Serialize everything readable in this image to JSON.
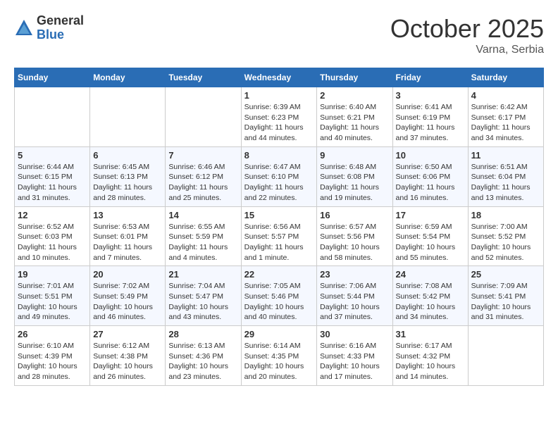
{
  "header": {
    "logo_general": "General",
    "logo_blue": "Blue",
    "month": "October 2025",
    "location": "Varna, Serbia"
  },
  "calendar": {
    "days_of_week": [
      "Sunday",
      "Monday",
      "Tuesday",
      "Wednesday",
      "Thursday",
      "Friday",
      "Saturday"
    ],
    "weeks": [
      [
        {
          "day": "",
          "info": ""
        },
        {
          "day": "",
          "info": ""
        },
        {
          "day": "",
          "info": ""
        },
        {
          "day": "1",
          "info": "Sunrise: 6:39 AM\nSunset: 6:23 PM\nDaylight: 11 hours\nand 44 minutes."
        },
        {
          "day": "2",
          "info": "Sunrise: 6:40 AM\nSunset: 6:21 PM\nDaylight: 11 hours\nand 40 minutes."
        },
        {
          "day": "3",
          "info": "Sunrise: 6:41 AM\nSunset: 6:19 PM\nDaylight: 11 hours\nand 37 minutes."
        },
        {
          "day": "4",
          "info": "Sunrise: 6:42 AM\nSunset: 6:17 PM\nDaylight: 11 hours\nand 34 minutes."
        }
      ],
      [
        {
          "day": "5",
          "info": "Sunrise: 6:44 AM\nSunset: 6:15 PM\nDaylight: 11 hours\nand 31 minutes."
        },
        {
          "day": "6",
          "info": "Sunrise: 6:45 AM\nSunset: 6:13 PM\nDaylight: 11 hours\nand 28 minutes."
        },
        {
          "day": "7",
          "info": "Sunrise: 6:46 AM\nSunset: 6:12 PM\nDaylight: 11 hours\nand 25 minutes."
        },
        {
          "day": "8",
          "info": "Sunrise: 6:47 AM\nSunset: 6:10 PM\nDaylight: 11 hours\nand 22 minutes."
        },
        {
          "day": "9",
          "info": "Sunrise: 6:48 AM\nSunset: 6:08 PM\nDaylight: 11 hours\nand 19 minutes."
        },
        {
          "day": "10",
          "info": "Sunrise: 6:50 AM\nSunset: 6:06 PM\nDaylight: 11 hours\nand 16 minutes."
        },
        {
          "day": "11",
          "info": "Sunrise: 6:51 AM\nSunset: 6:04 PM\nDaylight: 11 hours\nand 13 minutes."
        }
      ],
      [
        {
          "day": "12",
          "info": "Sunrise: 6:52 AM\nSunset: 6:03 PM\nDaylight: 11 hours\nand 10 minutes."
        },
        {
          "day": "13",
          "info": "Sunrise: 6:53 AM\nSunset: 6:01 PM\nDaylight: 11 hours\nand 7 minutes."
        },
        {
          "day": "14",
          "info": "Sunrise: 6:55 AM\nSunset: 5:59 PM\nDaylight: 11 hours\nand 4 minutes."
        },
        {
          "day": "15",
          "info": "Sunrise: 6:56 AM\nSunset: 5:57 PM\nDaylight: 11 hours\nand 1 minute."
        },
        {
          "day": "16",
          "info": "Sunrise: 6:57 AM\nSunset: 5:56 PM\nDaylight: 10 hours\nand 58 minutes."
        },
        {
          "day": "17",
          "info": "Sunrise: 6:59 AM\nSunset: 5:54 PM\nDaylight: 10 hours\nand 55 minutes."
        },
        {
          "day": "18",
          "info": "Sunrise: 7:00 AM\nSunset: 5:52 PM\nDaylight: 10 hours\nand 52 minutes."
        }
      ],
      [
        {
          "day": "19",
          "info": "Sunrise: 7:01 AM\nSunset: 5:51 PM\nDaylight: 10 hours\nand 49 minutes."
        },
        {
          "day": "20",
          "info": "Sunrise: 7:02 AM\nSunset: 5:49 PM\nDaylight: 10 hours\nand 46 minutes."
        },
        {
          "day": "21",
          "info": "Sunrise: 7:04 AM\nSunset: 5:47 PM\nDaylight: 10 hours\nand 43 minutes."
        },
        {
          "day": "22",
          "info": "Sunrise: 7:05 AM\nSunset: 5:46 PM\nDaylight: 10 hours\nand 40 minutes."
        },
        {
          "day": "23",
          "info": "Sunrise: 7:06 AM\nSunset: 5:44 PM\nDaylight: 10 hours\nand 37 minutes."
        },
        {
          "day": "24",
          "info": "Sunrise: 7:08 AM\nSunset: 5:42 PM\nDaylight: 10 hours\nand 34 minutes."
        },
        {
          "day": "25",
          "info": "Sunrise: 7:09 AM\nSunset: 5:41 PM\nDaylight: 10 hours\nand 31 minutes."
        }
      ],
      [
        {
          "day": "26",
          "info": "Sunrise: 6:10 AM\nSunset: 4:39 PM\nDaylight: 10 hours\nand 28 minutes."
        },
        {
          "day": "27",
          "info": "Sunrise: 6:12 AM\nSunset: 4:38 PM\nDaylight: 10 hours\nand 26 minutes."
        },
        {
          "day": "28",
          "info": "Sunrise: 6:13 AM\nSunset: 4:36 PM\nDaylight: 10 hours\nand 23 minutes."
        },
        {
          "day": "29",
          "info": "Sunrise: 6:14 AM\nSunset: 4:35 PM\nDaylight: 10 hours\nand 20 minutes."
        },
        {
          "day": "30",
          "info": "Sunrise: 6:16 AM\nSunset: 4:33 PM\nDaylight: 10 hours\nand 17 minutes."
        },
        {
          "day": "31",
          "info": "Sunrise: 6:17 AM\nSunset: 4:32 PM\nDaylight: 10 hours\nand 14 minutes."
        },
        {
          "day": "",
          "info": ""
        }
      ]
    ]
  }
}
